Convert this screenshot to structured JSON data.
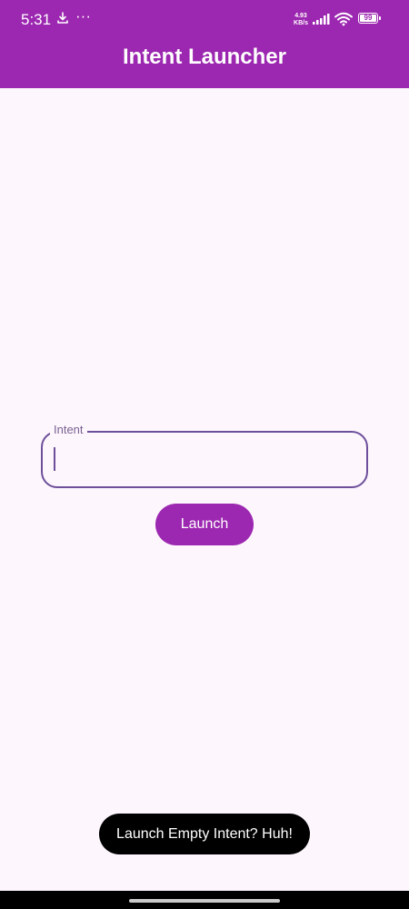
{
  "status_bar": {
    "time": "5:31",
    "download_icon": "download-icon",
    "more": "···",
    "speed_value": "4.93",
    "speed_unit": "KB/s",
    "battery_level": "99"
  },
  "app_bar": {
    "title": "Intent Launcher",
    "background_color": "#9c27b0"
  },
  "intent_field": {
    "label": "Intent",
    "value": "",
    "border_color": "#6d4f9a"
  },
  "launch_button": {
    "label": "Launch",
    "color": "#9c27b0"
  },
  "toast": {
    "message": "Launch Empty Intent? Huh!"
  }
}
